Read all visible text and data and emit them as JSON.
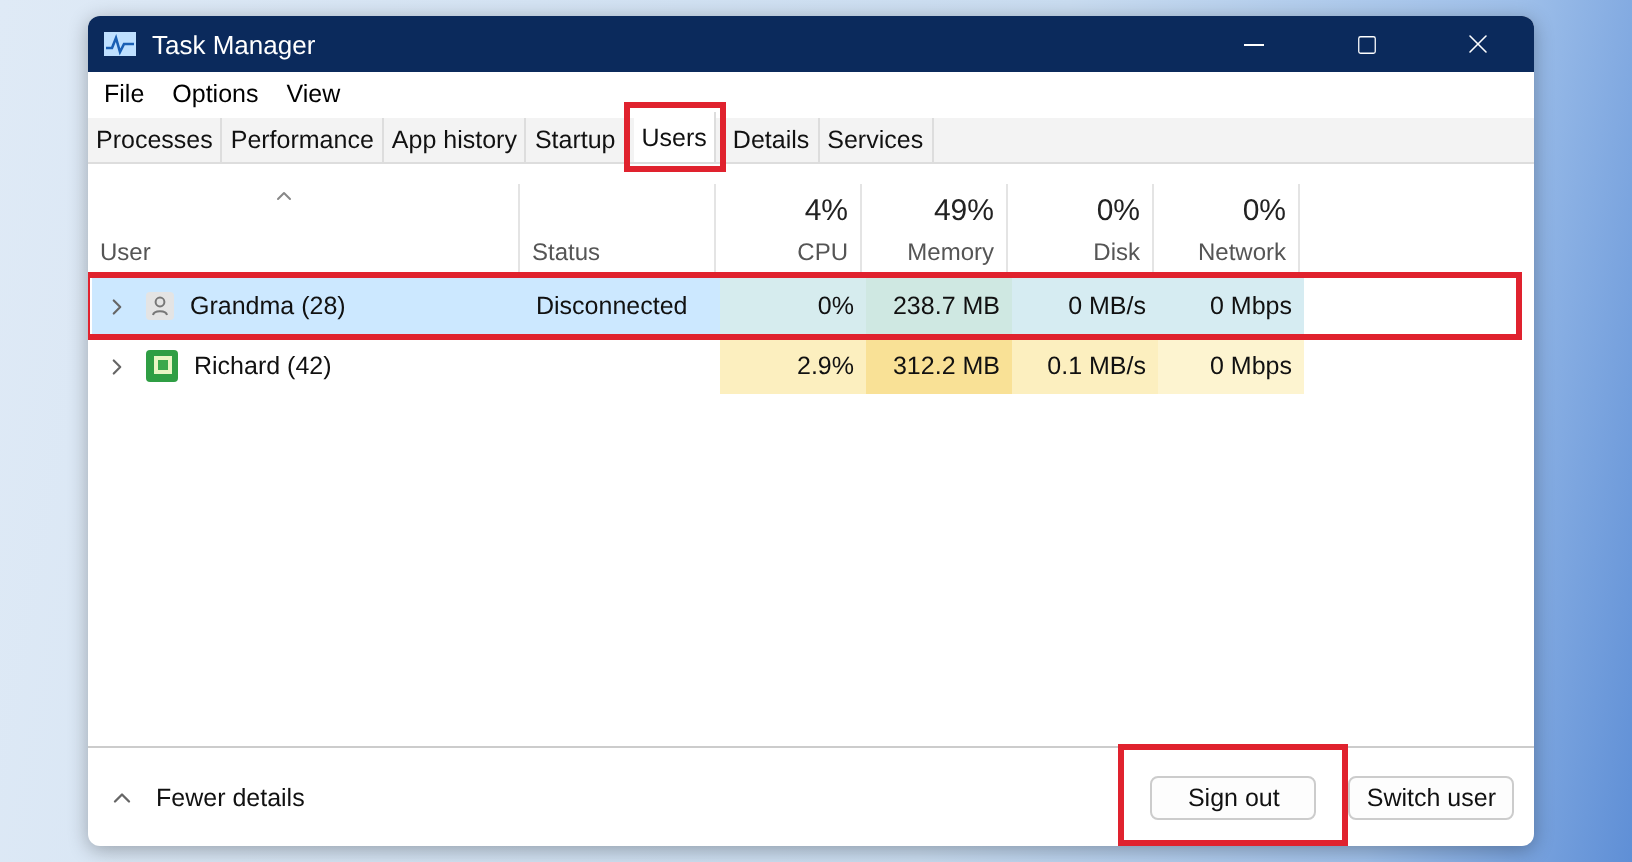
{
  "window": {
    "title": "Task Manager"
  },
  "menu": [
    "File",
    "Options",
    "View"
  ],
  "tabs": [
    {
      "label": "Processes",
      "selected": false,
      "highlighted": false
    },
    {
      "label": "Performance",
      "selected": false,
      "highlighted": false
    },
    {
      "label": "App history",
      "selected": false,
      "highlighted": false
    },
    {
      "label": "Startup",
      "selected": false,
      "highlighted": false
    },
    {
      "label": "Users",
      "selected": true,
      "highlighted": true
    },
    {
      "label": "Details",
      "selected": false,
      "highlighted": false
    },
    {
      "label": "Services",
      "selected": false,
      "highlighted": false
    }
  ],
  "table": {
    "columns": [
      {
        "label": "User"
      },
      {
        "label": "Status"
      },
      {
        "label": "CPU",
        "usage": "4%"
      },
      {
        "label": "Memory",
        "usage": "49%"
      },
      {
        "label": "Disk",
        "usage": "0%"
      },
      {
        "label": "Network",
        "usage": "0%"
      }
    ],
    "rows": [
      {
        "kind": "generic",
        "selected": true,
        "highlighted": true,
        "cells": [
          {
            "text": "Grandma (28)"
          },
          {
            "text": "Disconnected"
          },
          {
            "text": "0%",
            "color": "#d6ecee"
          },
          {
            "text": "238.7 MB",
            "color": "#cfe8e2"
          },
          {
            "text": "0 MB/s",
            "color": "#d6ecf2"
          },
          {
            "text": "0 Mbps",
            "color": "#d6ecf2"
          }
        ]
      },
      {
        "kind": "picture",
        "selected": false,
        "highlighted": false,
        "cells": [
          {
            "text": "Richard (42)"
          },
          {
            "text": ""
          },
          {
            "text": "2.9%",
            "color": "#fcefbf"
          },
          {
            "text": "312.2 MB",
            "color": "#f9e196"
          },
          {
            "text": "0.1 MB/s",
            "color": "#fcefbf"
          },
          {
            "text": "0 Mbps",
            "color": "#fdf4d0"
          }
        ]
      }
    ]
  },
  "footer": {
    "toggle": "Fewer details",
    "buttons": [
      {
        "label": "Sign out",
        "highlighted": true
      },
      {
        "label": "Switch user",
        "highlighted": false
      }
    ]
  }
}
